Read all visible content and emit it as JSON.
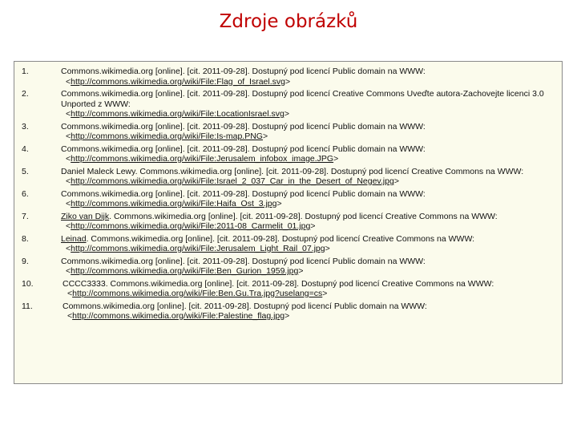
{
  "title": "Zdroje obrázků",
  "references": [
    {
      "number": "1.",
      "author": "",
      "citation": "Commons.wikimedia.org [online]. [cit. 2011-09-28]. Dostupný pod licencí Public domain na WWW:",
      "url": "http://commons.wikimedia.org/wiki/File:Flag_of_Israel.svg"
    },
    {
      "number": "2.",
      "author": "",
      "citation": "Commons.wikimedia.org [online]. [cit. 2011-09-28]. Dostupný pod licencí Creative Commons Uveďte autora-Zachovejte licenci 3.0 Unported z WWW:",
      "url": "http://commons.wikimedia.org/wiki/File:LocationIsrael.svg"
    },
    {
      "number": "3.",
      "author": "",
      "citation": "Commons.wikimedia.org [online]. [cit. 2011-09-28]. Dostupný pod licencí Public domain na WWW:",
      "url": "http://commons.wikimedia.org/wiki/File:Is-map.PNG"
    },
    {
      "number": "4.",
      "author": "",
      "citation": "Commons.wikimedia.org [online]. [cit. 2011-09-28]. Dostupný pod licencí Public domain na WWW:",
      "url": "http://commons.wikimedia.org/wiki/File:Jerusalem_infobox_image.JPG"
    },
    {
      "number": "5.",
      "author": "",
      "citation": "Daniel Maleck Lewy. Commons.wikimedia.org [online]. [cit. 2011-09-28]. Dostupný pod licencí Creative Commons na WWW:",
      "url": "http://commons.wikimedia.org/wiki/File:Israel_2_037_Car_in_the_Desert_of_Negev.jpg"
    },
    {
      "number": "6.",
      "author": "",
      "citation": "Commons.wikimedia.org [online]. [cit. 2011-09-28]. Dostupný pod licencí Public domain na WWW:",
      "url": "http://commons.wikimedia.org/wiki/File:Haifa_Ost_3.jpg"
    },
    {
      "number": "7.",
      "author": "Ziko van Dijk",
      "citation": ". Commons.wikimedia.org [online]. [cit. 2011-09-28]. Dostupný pod licencí Creative Commons na WWW:",
      "url": "http://commons.wikimedia.org/wiki/File:2011-08_Carmelit_01.jpg"
    },
    {
      "number": "8.",
      "author": "Leinad",
      "citation": ". Commons.wikimedia.org [online]. [cit. 2011-09-28]. Dostupný pod licencí Creative Commons na WWW:",
      "url": "http://commons.wikimedia.org/wiki/File:Jerusalem_Light_Rail_07.jpg"
    },
    {
      "number": "9.",
      "author": "",
      "citation": "Commons.wikimedia.org [online]. [cit. 2011-09-28]. Dostupný pod licencí Public domain na WWW:",
      "url": "http://commons.wikimedia.org/wiki/File:Ben_Gurion_1959.jpg"
    },
    {
      "number": "10.",
      "author": "",
      "citation": "CCCC3333. Commons.wikimedia.org [online]. [cit. 2011-09-28]. Dostupný pod licencí Creative Commons na WWW:",
      "url": "http://commons.wikimedia.org/wiki/File:Ben.Gu.Tra.jpg?uselang=cs"
    },
    {
      "number": "11.",
      "author": "",
      "citation": "Commons.wikimedia.org [online]. [cit. 2011-09-28]. Dostupný pod licencí Public domain na WWW:",
      "url": "http://commons.wikimedia.org/wiki/File:Palestine_flag.jpg"
    }
  ]
}
